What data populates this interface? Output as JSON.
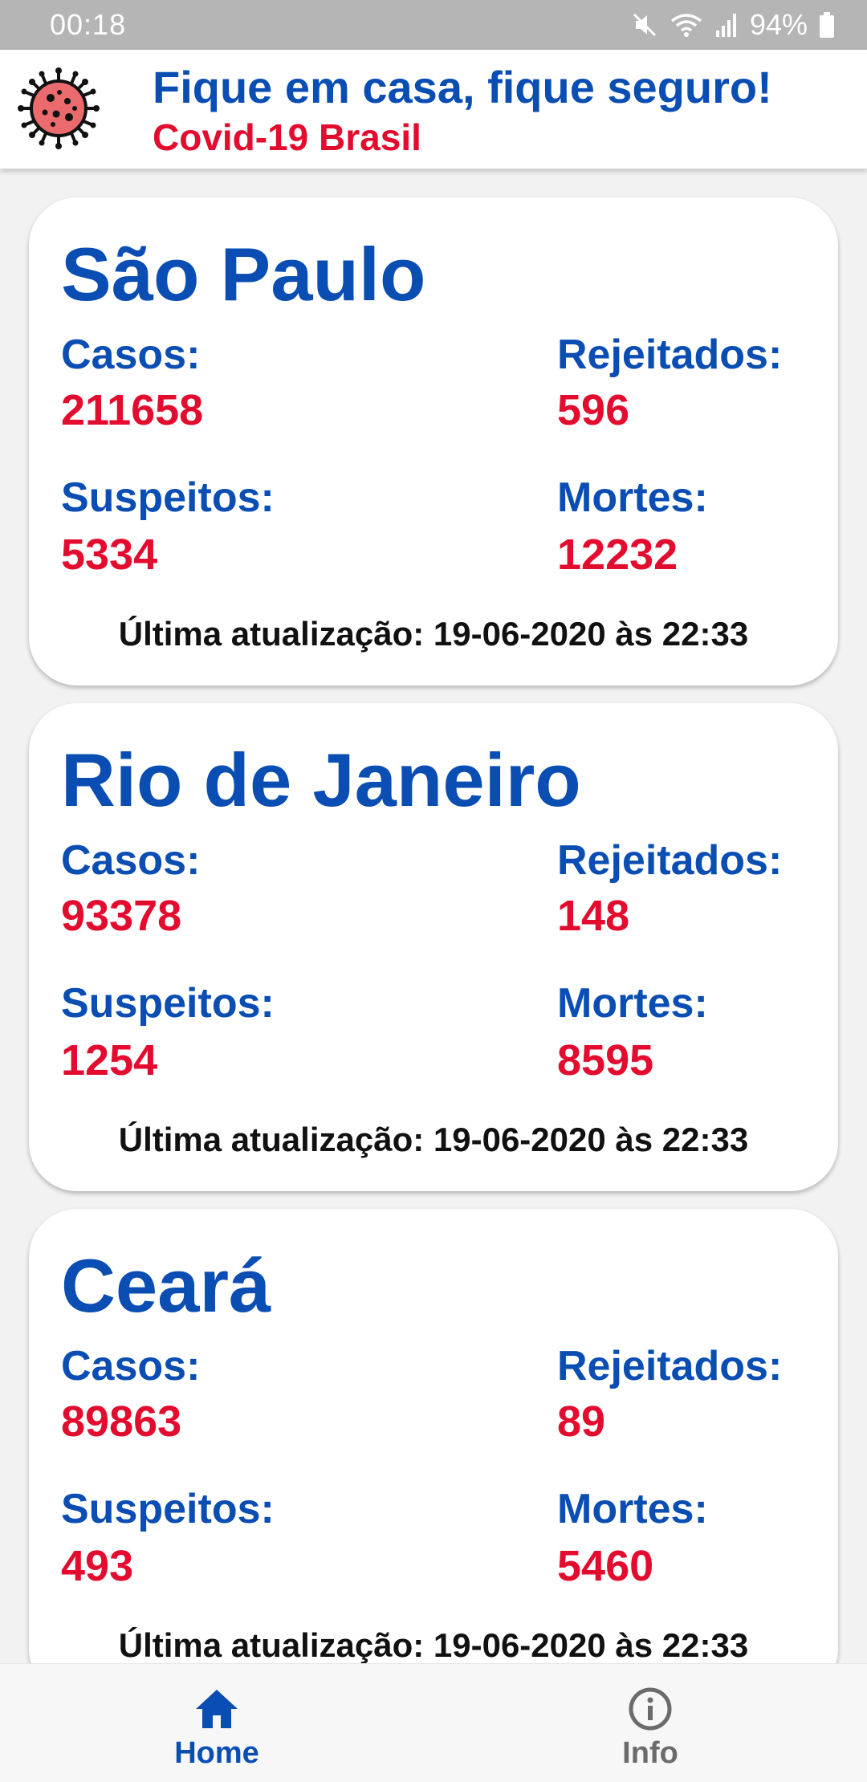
{
  "status_bar": {
    "time": "00:18",
    "battery": "94%",
    "icons": [
      "mute-icon",
      "wifi-icon",
      "signal-icon",
      "battery-icon"
    ]
  },
  "header": {
    "logo_icon": "virus-icon",
    "title": "Fique em casa, fique seguro!",
    "subtitle": "Covid-19 Brasil"
  },
  "labels": {
    "casos": "Casos:",
    "rejeitados": "Rejeitados:",
    "suspeitos": "Suspeitos:",
    "mortes": "Mortes:"
  },
  "cards": [
    {
      "state": "São Paulo",
      "casos": "211658",
      "rejeitados": "596",
      "suspeitos": "5334",
      "mortes": "12232",
      "updated": "Última atualização: 19-06-2020 às 22:33"
    },
    {
      "state": "Rio de Janeiro",
      "casos": "93378",
      "rejeitados": "148",
      "suspeitos": "1254",
      "mortes": "8595",
      "updated": "Última atualização: 19-06-2020 às 22:33"
    },
    {
      "state": "Ceará",
      "casos": "89863",
      "rejeitados": "89",
      "suspeitos": "493",
      "mortes": "5460",
      "updated": "Última atualização: 19-06-2020 às 22:33"
    }
  ],
  "nav": {
    "home": {
      "label": "Home",
      "icon": "home-icon",
      "active": true
    },
    "info": {
      "label": "Info",
      "icon": "info-icon",
      "active": false
    }
  },
  "colors": {
    "primary_blue": "#0a4db3",
    "accent_red": "#e30b2e",
    "background": "#f2f2f2",
    "status_bar": "#b5b5b5"
  }
}
